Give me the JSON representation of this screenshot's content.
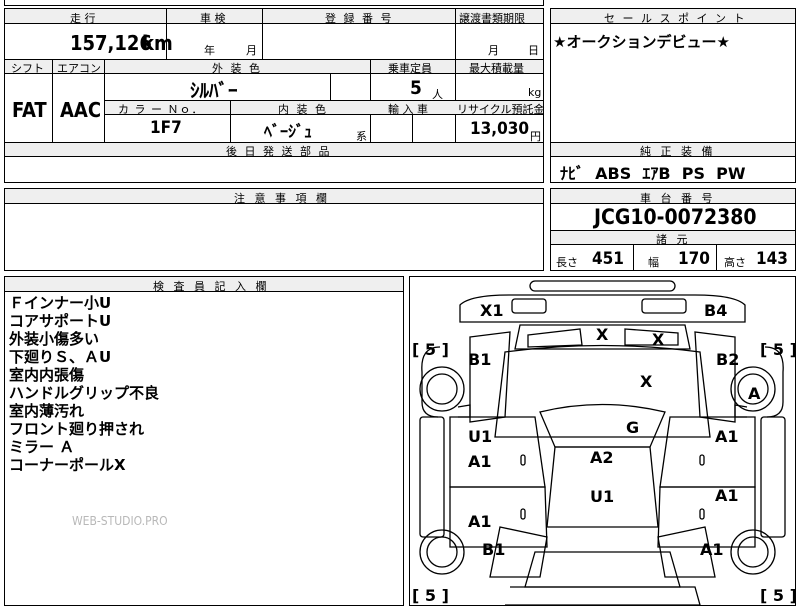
{
  "top_fragment": "■■■■■",
  "mileage": {
    "label": "走 行",
    "value": "157,126",
    "unit": "km"
  },
  "inspection": {
    "label": "車 検",
    "year": "年",
    "month": "月"
  },
  "registration": {
    "label": "登 録 番 号",
    "value": ""
  },
  "transfer": {
    "label": "譲渡書類期限",
    "month": "月",
    "day": "日"
  },
  "shift": {
    "label": "シフト",
    "value": "FAT"
  },
  "aircon": {
    "label": "エアコン",
    "value": "AAC"
  },
  "exterior": {
    "label": "外 装 色",
    "value": "ｼﾙﾊﾞｰ"
  },
  "capacity": {
    "label": "乗車定員",
    "value": "5",
    "unit": "人"
  },
  "max_load": {
    "label": "最大積載量",
    "unit": "kg"
  },
  "color_no": {
    "label": "カ ラ ー Ｎｏ．",
    "value": "1F7"
  },
  "interior": {
    "label": "内 装 色",
    "value": "ﾍﾞｰｼﾞｭ",
    "suffix": "系"
  },
  "import": {
    "label": "輸 入 車"
  },
  "recycle": {
    "label": "リサイクル預託金",
    "value": "13,030",
    "unit": "円"
  },
  "later_parts": {
    "label": "後 日 発 送 部 品"
  },
  "notice": {
    "label": "注 意 事 項 欄"
  },
  "sales_point": {
    "label": "セ ー ル ス ポ イ ン ト",
    "text": "★オークションデビュー★"
  },
  "genuine": {
    "label": "純 正 装 備",
    "text": "ﾅﾋﾞ  ABS  ｴｱB  PS  PW"
  },
  "chassis": {
    "label": "車 台 番 号",
    "value": "JCG10-0072380"
  },
  "specs": {
    "label": "諸 元",
    "length_label": "長さ",
    "length": "451",
    "width_label": "幅",
    "width": "170",
    "height_label": "高さ",
    "height": "143"
  },
  "inspector": {
    "label": "検 査 員 記 入 欄",
    "notes": [
      "Ｆインナー小U",
      "コアサポートU",
      "外装小傷多い",
      "下廻りＳ、ＡU",
      "室内内張傷",
      "ハンドルグリップ不良",
      "室内薄汚れ",
      "フロント廻り押され",
      "ミラー Ａ",
      "コーナーポールX"
    ],
    "watermark": "WEB-STUDIO.PRO"
  },
  "diagram": {
    "marks": {
      "front_left": "X1",
      "front_right": "B4",
      "hood_left": "X",
      "hood_right": "X",
      "hood_center": "X",
      "fender_fl": "B1",
      "fender_fr": "B2",
      "wheel_fr": "A",
      "windshield": "G",
      "door_fl_top": "U1",
      "door_fl_bot": "A1",
      "door_fr": "A1",
      "roof": "A2",
      "roof_rear": "U1",
      "door_rr": "A1",
      "door_rl": "A1",
      "fender_rl": "B1",
      "fender_rr": "A1"
    },
    "tires": {
      "fl": "5",
      "fr": "5",
      "rl": "5",
      "rr": "5"
    }
  }
}
